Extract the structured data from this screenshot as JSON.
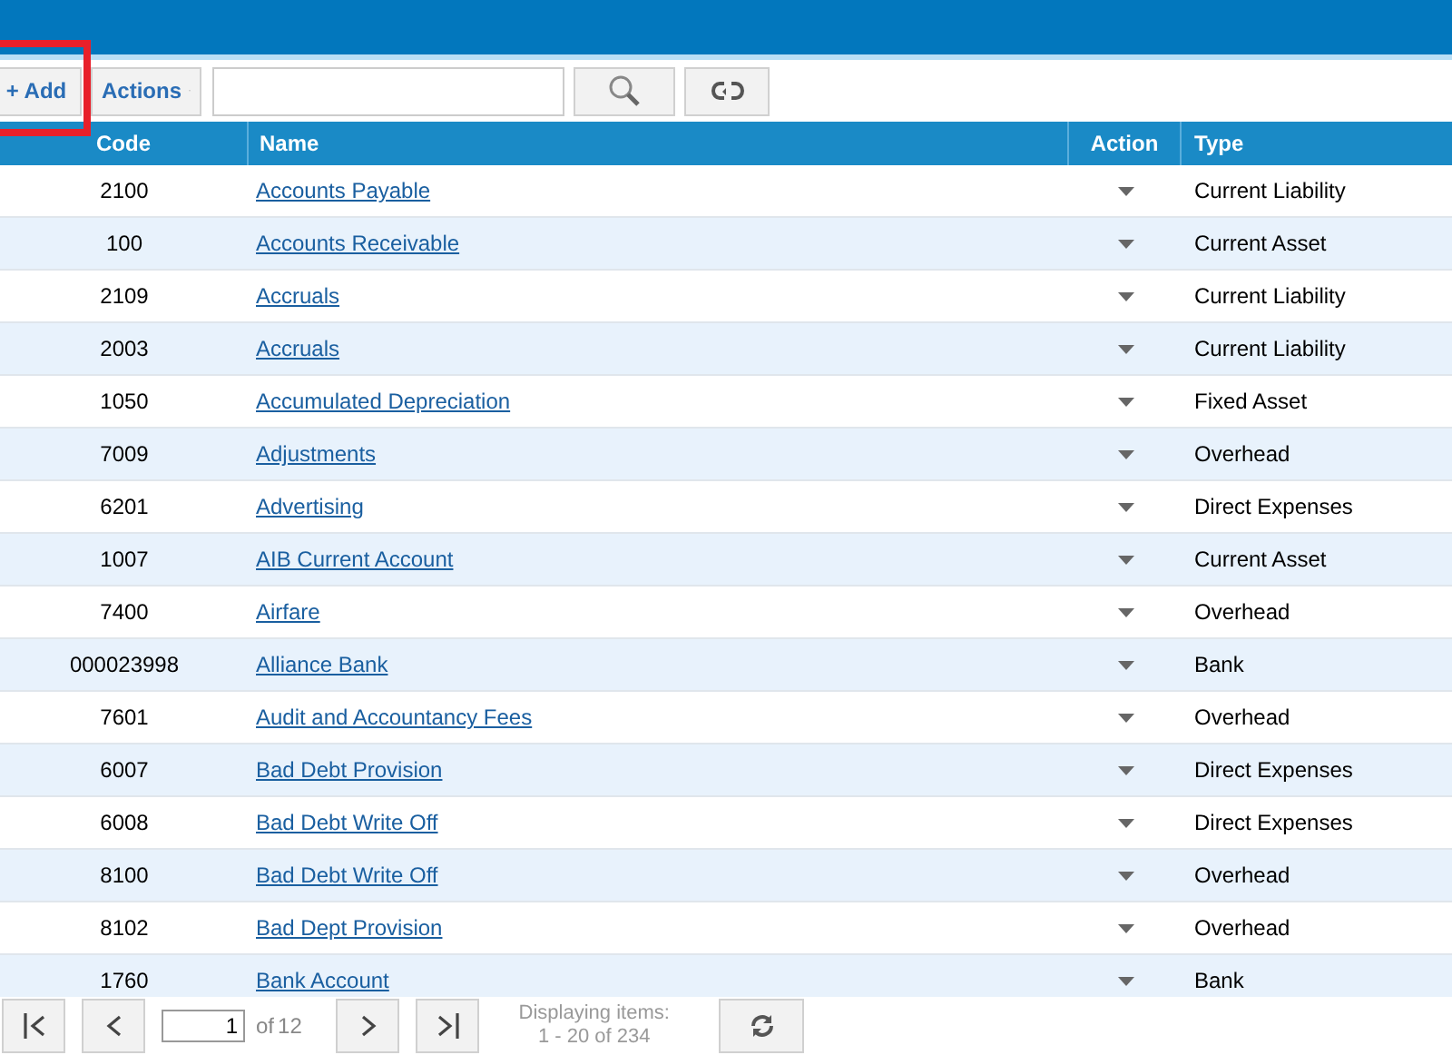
{
  "toolbar": {
    "add_button": "+ Add",
    "actions_button": "Actions"
  },
  "table": {
    "columns": [
      "Code",
      "Name",
      "Action",
      "Type"
    ],
    "rows": [
      {
        "code": "2100",
        "name": "Accounts Payable",
        "type": "Current Liability"
      },
      {
        "code": "100",
        "name": "Accounts Receivable",
        "type": "Current Asset"
      },
      {
        "code": "2109",
        "name": "Accruals",
        "type": "Current Liability"
      },
      {
        "code": "2003",
        "name": "Accruals",
        "type": "Current Liability"
      },
      {
        "code": "1050",
        "name": "Accumulated Depreciation",
        "type": "Fixed Asset"
      },
      {
        "code": "7009",
        "name": "Adjustments",
        "type": "Overhead"
      },
      {
        "code": "6201",
        "name": "Advertising",
        "type": "Direct Expenses"
      },
      {
        "code": "1007",
        "name": "AIB Current Account",
        "type": "Current Asset"
      },
      {
        "code": "7400",
        "name": "Airfare",
        "type": "Overhead"
      },
      {
        "code": "000023998",
        "name": "Alliance Bank",
        "type": "Bank"
      },
      {
        "code": "7601",
        "name": "Audit and Accountancy Fees",
        "type": "Overhead"
      },
      {
        "code": "6007",
        "name": "Bad Debt Provision",
        "type": "Direct Expenses"
      },
      {
        "code": "6008",
        "name": "Bad Debt Write Off",
        "type": "Direct Expenses"
      },
      {
        "code": "8100",
        "name": "Bad Debt Write Off",
        "type": "Overhead"
      },
      {
        "code": "8102",
        "name": "Bad Dept Provision",
        "type": "Overhead"
      },
      {
        "code": "1760",
        "name": "Bank Account",
        "type": "Bank"
      }
    ]
  },
  "pager": {
    "page": "1",
    "of_label": "of",
    "total_pages": "12",
    "display_label": "Displaying items:",
    "display_range": "1 - 20 of 234"
  }
}
